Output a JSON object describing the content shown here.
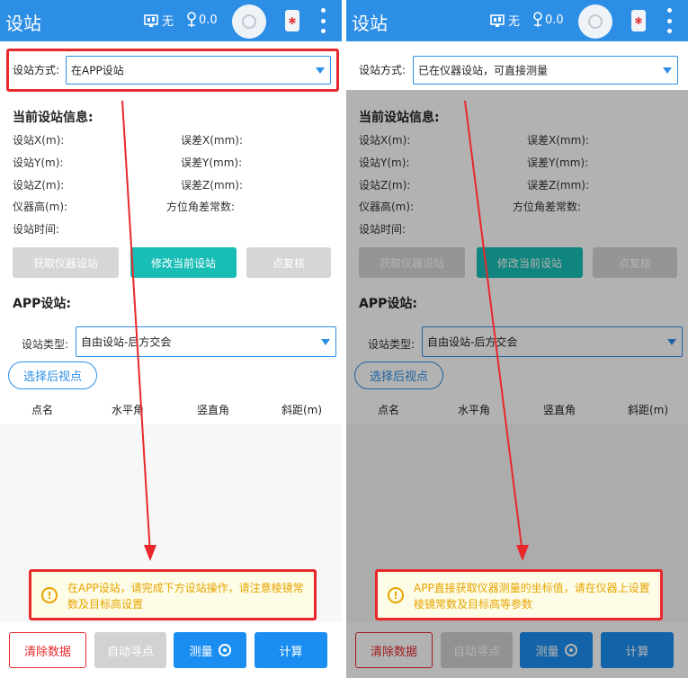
{
  "left": {
    "topbar": {
      "title": "设站",
      "signal_text": "无",
      "gps_value": "0.0"
    },
    "mode": {
      "label": "设站方式:",
      "value": "在APP设站"
    },
    "current_info": {
      "title": "当前设站信息:",
      "station_x": "设站X(m):",
      "station_y": "设站Y(m):",
      "station_z": "设站Z(m):",
      "instrument_height": "仪器高(m):",
      "station_time": "设站时间:",
      "error_x": "误差X(mm):",
      "error_y": "误差Y(mm):",
      "error_z": "误差Z(mm):",
      "azimuth_const": "方位角差常数:"
    },
    "buttons": {
      "get_station": "获取仪器设站",
      "modify_station": "修改当前设站",
      "point_check": "点复核"
    },
    "app_station": {
      "title": "APP设站:",
      "type_label": "设站类型:",
      "type_value": "自由设站-后方交会",
      "select_backsight": "选择后视点"
    },
    "table_headers": [
      "点名",
      "水平角",
      "竖直角",
      "斜距(m)"
    ],
    "notice": "在APP设站，请完成下方设站操作，请注意棱镜常数及目标高设置",
    "bottom": {
      "clear": "清除数据",
      "auto_search": "自动寻点",
      "measure": "测量",
      "calculate": "计算"
    }
  },
  "right": {
    "topbar": {
      "title": "设站",
      "signal_text": "无",
      "gps_value": "0.0"
    },
    "mode": {
      "label": "设站方式:",
      "value": "已在仪器设站，可直接测量"
    },
    "current_info": {
      "title": "当前设站信息:",
      "station_x": "设站X(m):",
      "station_y": "设站Y(m):",
      "station_z": "设站Z(m):",
      "instrument_height": "仪器高(m):",
      "station_time": "设站时间:",
      "error_x": "误差X(mm):",
      "error_y": "误差Y(mm):",
      "error_z": "误差Z(mm):",
      "azimuth_const": "方位角差常数:"
    },
    "buttons": {
      "get_station": "获取仪器设站",
      "modify_station": "修改当前设站",
      "point_check": "点复核"
    },
    "app_station": {
      "title": "APP设站:",
      "type_label": "设站类型:",
      "type_value": "自由设站-后方交会",
      "select_backsight": "选择后视点"
    },
    "table_headers": [
      "点名",
      "水平角",
      "竖直角",
      "斜距(m)"
    ],
    "notice": "APP直接获取仪器测量的坐标值，请在仪器上设置棱镜常数及目标高等参数",
    "bottom": {
      "clear": "清除数据",
      "auto_search": "自动寻点",
      "measure": "测量",
      "calculate": "计算"
    }
  },
  "colors": {
    "primary": "#2d8ee6",
    "teal": "#18bdb5",
    "annotation_red": "#e8282b",
    "warning": "#e8a400"
  }
}
